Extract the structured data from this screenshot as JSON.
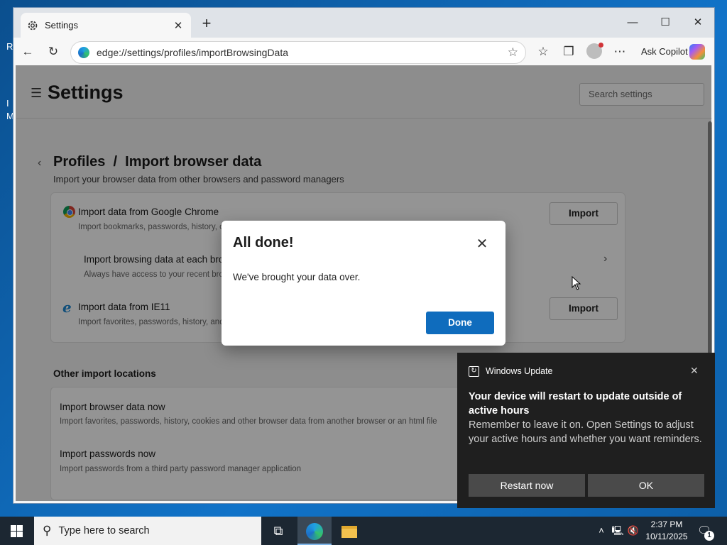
{
  "desktop": {
    "letters": [
      "R",
      "I",
      "M"
    ]
  },
  "browser": {
    "tab_title": "Settings",
    "tab_close": "✕",
    "new_tab": "+",
    "window_controls": {
      "minimize": "—",
      "maximize": "☐",
      "close": "✕"
    },
    "nav": {
      "back": "←",
      "refresh": "↻"
    },
    "url": "edge://settings/profiles/importBrowsingData",
    "copilot_label": "Ask Copilot"
  },
  "settings": {
    "title": "Settings",
    "search_placeholder": "Search settings",
    "breadcrumb": "Profiles  /  Import browser data",
    "subtitle": "Import your browser data from other browsers and password managers",
    "import_rows": [
      {
        "title": "Import data from Google Chrome",
        "desc": "Import bookmarks, passwords, history, cookies and other browser data",
        "button": "Import"
      },
      {
        "title": "Import browsing data at each browser launch",
        "desc": "Always have access to your recent browsing data",
        "button": ""
      },
      {
        "title": "Import data from IE11",
        "desc": "Import favorites, passwords, history, and other browser data",
        "button": "Import"
      }
    ],
    "other_title": "Other import locations",
    "other_rows": [
      {
        "title": "Import browser data now",
        "desc": "Import favorites, passwords, history, cookies and other browser data from another browser or an html file"
      },
      {
        "title": "Import passwords now",
        "desc": "Import passwords from a third party password manager application"
      }
    ]
  },
  "dialog": {
    "title": "All done!",
    "message": "We've brought your data over.",
    "done_label": "Done",
    "close": "✕"
  },
  "toast": {
    "app": "Windows Update",
    "close": "✕",
    "heading": "Your device will restart to update outside of active hours",
    "body": "Remember to leave it on. Open Settings to adjust your active hours and whether you want reminders.",
    "restart_label": "Restart now",
    "ok_label": "OK"
  },
  "taskbar": {
    "search_placeholder": "Type here to search",
    "time": "2:37 PM",
    "date": "10/11/2025",
    "notification_count": "1"
  },
  "colors": {
    "accent": "#0f6cbd",
    "toast_bg": "#1f1f1f",
    "taskbar_bg": "#1c2732"
  }
}
